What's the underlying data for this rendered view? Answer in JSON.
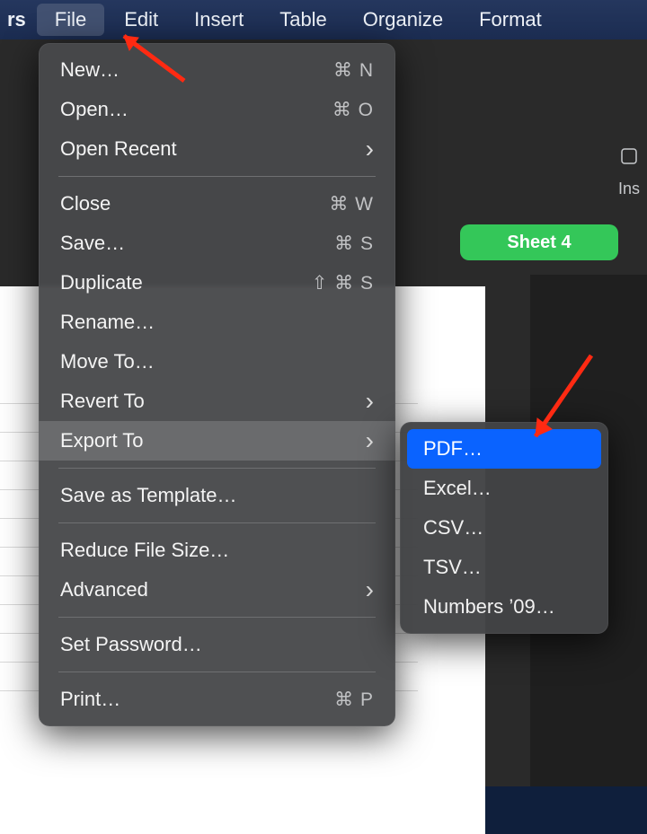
{
  "menubar": {
    "partial": "rs",
    "items": [
      "File",
      "Edit",
      "Insert",
      "Table",
      "Organize",
      "Format"
    ],
    "active_index": 0
  },
  "background": {
    "sheet_tab": "Sheet 4",
    "insert_label": "Ins"
  },
  "file_menu": [
    {
      "label": "New…",
      "shortcut": "⌘ N"
    },
    {
      "label": "Open…",
      "shortcut": "⌘ O"
    },
    {
      "label": "Open Recent",
      "chevron": true
    },
    {
      "sep": true
    },
    {
      "label": "Close",
      "shortcut": "⌘ W"
    },
    {
      "label": "Save…",
      "shortcut": "⌘ S"
    },
    {
      "label": "Duplicate",
      "shortcut": "⇧ ⌘ S"
    },
    {
      "label": "Rename…"
    },
    {
      "label": "Move To…"
    },
    {
      "label": "Revert To",
      "chevron": true
    },
    {
      "label": "Export To",
      "chevron": true,
      "highlight": true
    },
    {
      "sep": true
    },
    {
      "label": "Save as Template…"
    },
    {
      "sep": true
    },
    {
      "label": "Reduce File Size…"
    },
    {
      "label": "Advanced",
      "chevron": true
    },
    {
      "sep": true
    },
    {
      "label": "Set Password…"
    },
    {
      "sep": true
    },
    {
      "label": "Print…",
      "shortcut": "⌘ P"
    }
  ],
  "export_submenu": [
    {
      "label": "PDF…",
      "selected": true
    },
    {
      "label": "Excel…"
    },
    {
      "label": "CSV…"
    },
    {
      "label": "TSV…"
    },
    {
      "label": "Numbers ’09…"
    }
  ]
}
